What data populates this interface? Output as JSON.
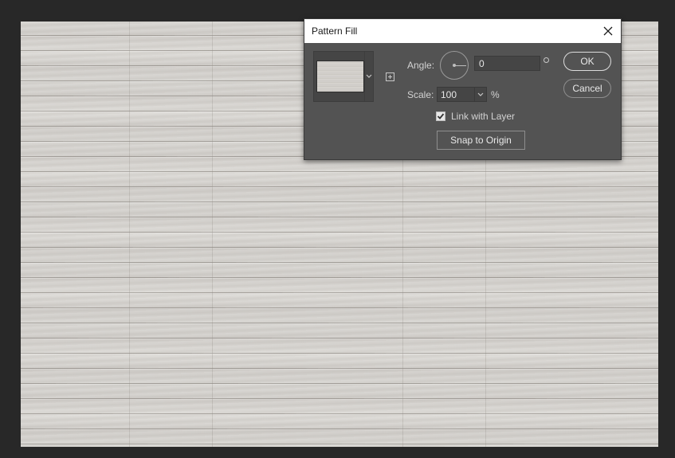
{
  "dialog": {
    "title": "Pattern Fill",
    "angle_label": "Angle:",
    "angle_value": "0",
    "degree_symbol": "°",
    "scale_label": "Scale:",
    "scale_value": "100",
    "percent_symbol": "%",
    "link_label": "Link with Layer",
    "link_checked": true,
    "snap_label": "Snap to Origin",
    "ok_label": "OK",
    "cancel_label": "Cancel"
  },
  "icons": {
    "close": "close-icon",
    "dropdown": "chevron-down-icon",
    "new_preset": "new-preset-icon",
    "checkmark": "checkmark-icon"
  },
  "colors": {
    "workspace_bg": "#282828",
    "dialog_bg": "#535353",
    "titlebar_bg": "#ffffff",
    "wood": "#d3d1cd"
  }
}
